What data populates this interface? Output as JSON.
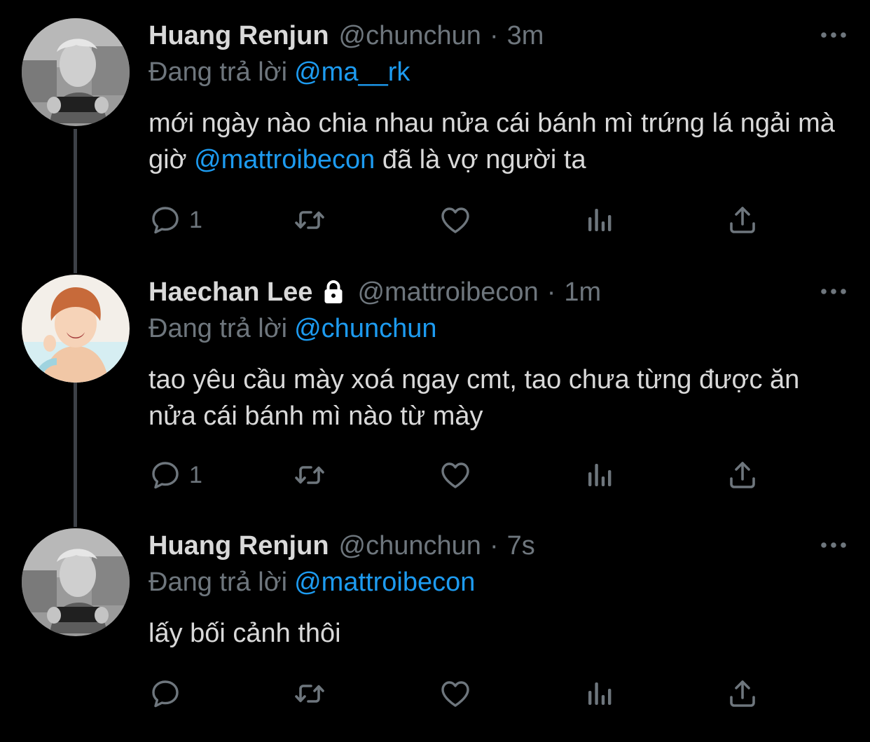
{
  "colors": {
    "background": "#000000",
    "text_primary": "#d9d9d9",
    "text_secondary": "#6e767d",
    "accent": "#1d9bf0",
    "thread_line": "#3d4147"
  },
  "tweets": [
    {
      "name": "Huang Renjun",
      "handle": "@chunchun",
      "separator": "·",
      "time": "3m",
      "reply_prefix": "Đang trả lời",
      "reply_to": "@ma__rk",
      "text_before": "mới ngày nào chia nhau nửa cái bánh mì trứng lá ngải mà giờ",
      "text_mention": "@mattroibecon",
      "text_after": "đã là vợ người ta",
      "reply_count": "1",
      "icons": [
        "reply-icon",
        "retweet-icon",
        "like-icon",
        "analytics-icon",
        "share-icon",
        "more-icon"
      ]
    },
    {
      "name": "Haechan Lee",
      "protected": true,
      "handle": "@mattroibecon",
      "separator": "·",
      "time": "1m",
      "reply_prefix": "Đang trả lời",
      "reply_to": "@chunchun",
      "text": "tao yêu cầu mày xoá ngay cmt, tao chưa từng được ăn nửa cái bánh mì nào từ mày",
      "reply_count": "1",
      "icons": [
        "lock-icon",
        "reply-icon",
        "retweet-icon",
        "like-icon",
        "analytics-icon",
        "share-icon",
        "more-icon"
      ]
    },
    {
      "name": "Huang Renjun",
      "handle": "@chunchun",
      "separator": "·",
      "time": "7s",
      "reply_prefix": "Đang trả lời",
      "reply_to": "@mattroibecon",
      "text": "lấy bối cảnh thôi",
      "icons": [
        "reply-icon",
        "retweet-icon",
        "like-icon",
        "analytics-icon",
        "share-icon",
        "more-icon"
      ]
    }
  ]
}
